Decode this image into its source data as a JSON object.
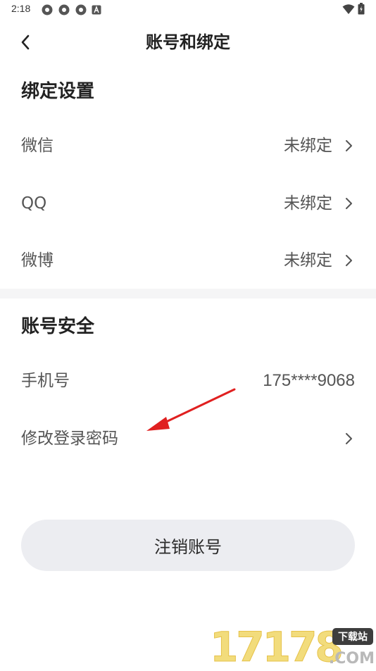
{
  "status_bar": {
    "time": "2:18",
    "left_icons": [
      "notification-icon",
      "notification-icon",
      "notification-icon",
      "app-icon"
    ],
    "right_icons": [
      "wifi-icon",
      "battery-icon"
    ]
  },
  "header": {
    "title": "账号和绑定"
  },
  "binding_section": {
    "title": "绑定设置",
    "rows": [
      {
        "label": "微信",
        "value": "未绑定"
      },
      {
        "label": "QQ",
        "value": "未绑定"
      },
      {
        "label": "微博",
        "value": "未绑定"
      }
    ]
  },
  "security_section": {
    "title": "账号安全",
    "phone": {
      "label": "手机号",
      "value": "175****9068"
    },
    "password": {
      "label": "修改登录密码"
    }
  },
  "cancel_account": {
    "label": "注销账号"
  },
  "watermark": {
    "digits": "17178",
    "tag": "下载站",
    "domain": ".COM"
  },
  "colors": {
    "accent_annotation": "#e02020",
    "button_bg": "#ecedf1",
    "divider_bg": "#f5f5f6"
  }
}
